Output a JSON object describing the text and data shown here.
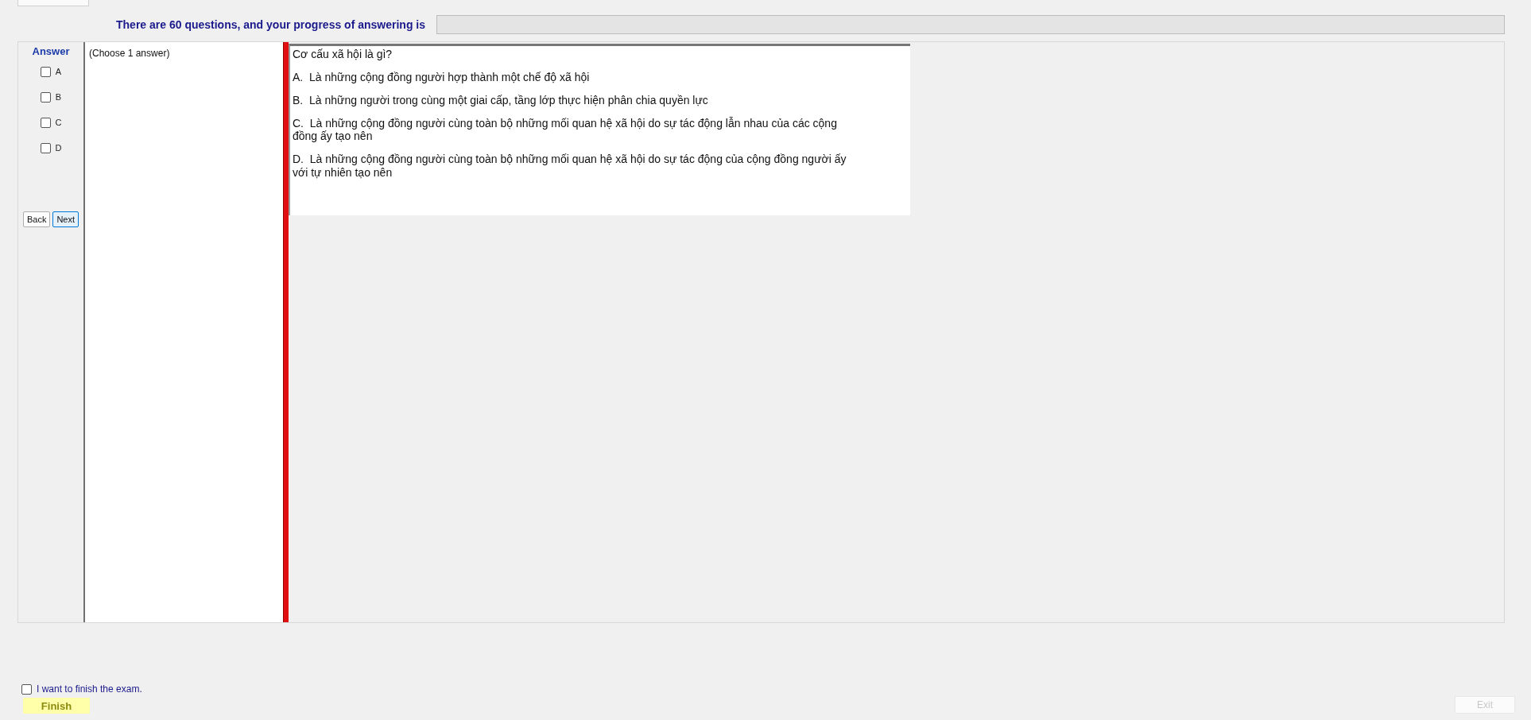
{
  "header": {
    "progress_label": "There are 60 questions, and your progress of answering is",
    "progress": {
      "level": 0
    }
  },
  "answer_panel": {
    "title": "Answer",
    "options": [
      {
        "label": "A",
        "checked": false
      },
      {
        "label": "B",
        "checked": false
      },
      {
        "label": "C",
        "checked": false
      },
      {
        "label": "D",
        "checked": false
      }
    ],
    "buttons": [
      {
        "label": "Back",
        "selected": false
      },
      {
        "label": "Next",
        "selected": true
      }
    ]
  },
  "instruction": "(Choose 1 answer)",
  "question": {
    "text": "Cơ cấu xã hội là gì?",
    "choices": [
      "A.  Là những cộng đồng người hợp thành một chế độ xã hội",
      "B.  Là những người trong cùng một giai cấp, tầng lớp thực hiện phân chia quyền lực",
      "C.  Là những cộng đồng người cùng toàn bộ những mối quan hệ xã hội do sự tác động lẫn nhau của các cộng đồng ấy tạo nên",
      "D.  Là những cộng đồng người cùng toàn bộ những mối quan hệ xã hội do sự tác động của cộng đồng người ấy với tự nhiên tạo nên"
    ]
  },
  "footer": {
    "finish_check": {
      "label": "I want to finish the exam.",
      "checked": false
    },
    "finish_button": "Finish",
    "exit_button": {
      "label": "Exit",
      "disabled": true
    }
  }
}
